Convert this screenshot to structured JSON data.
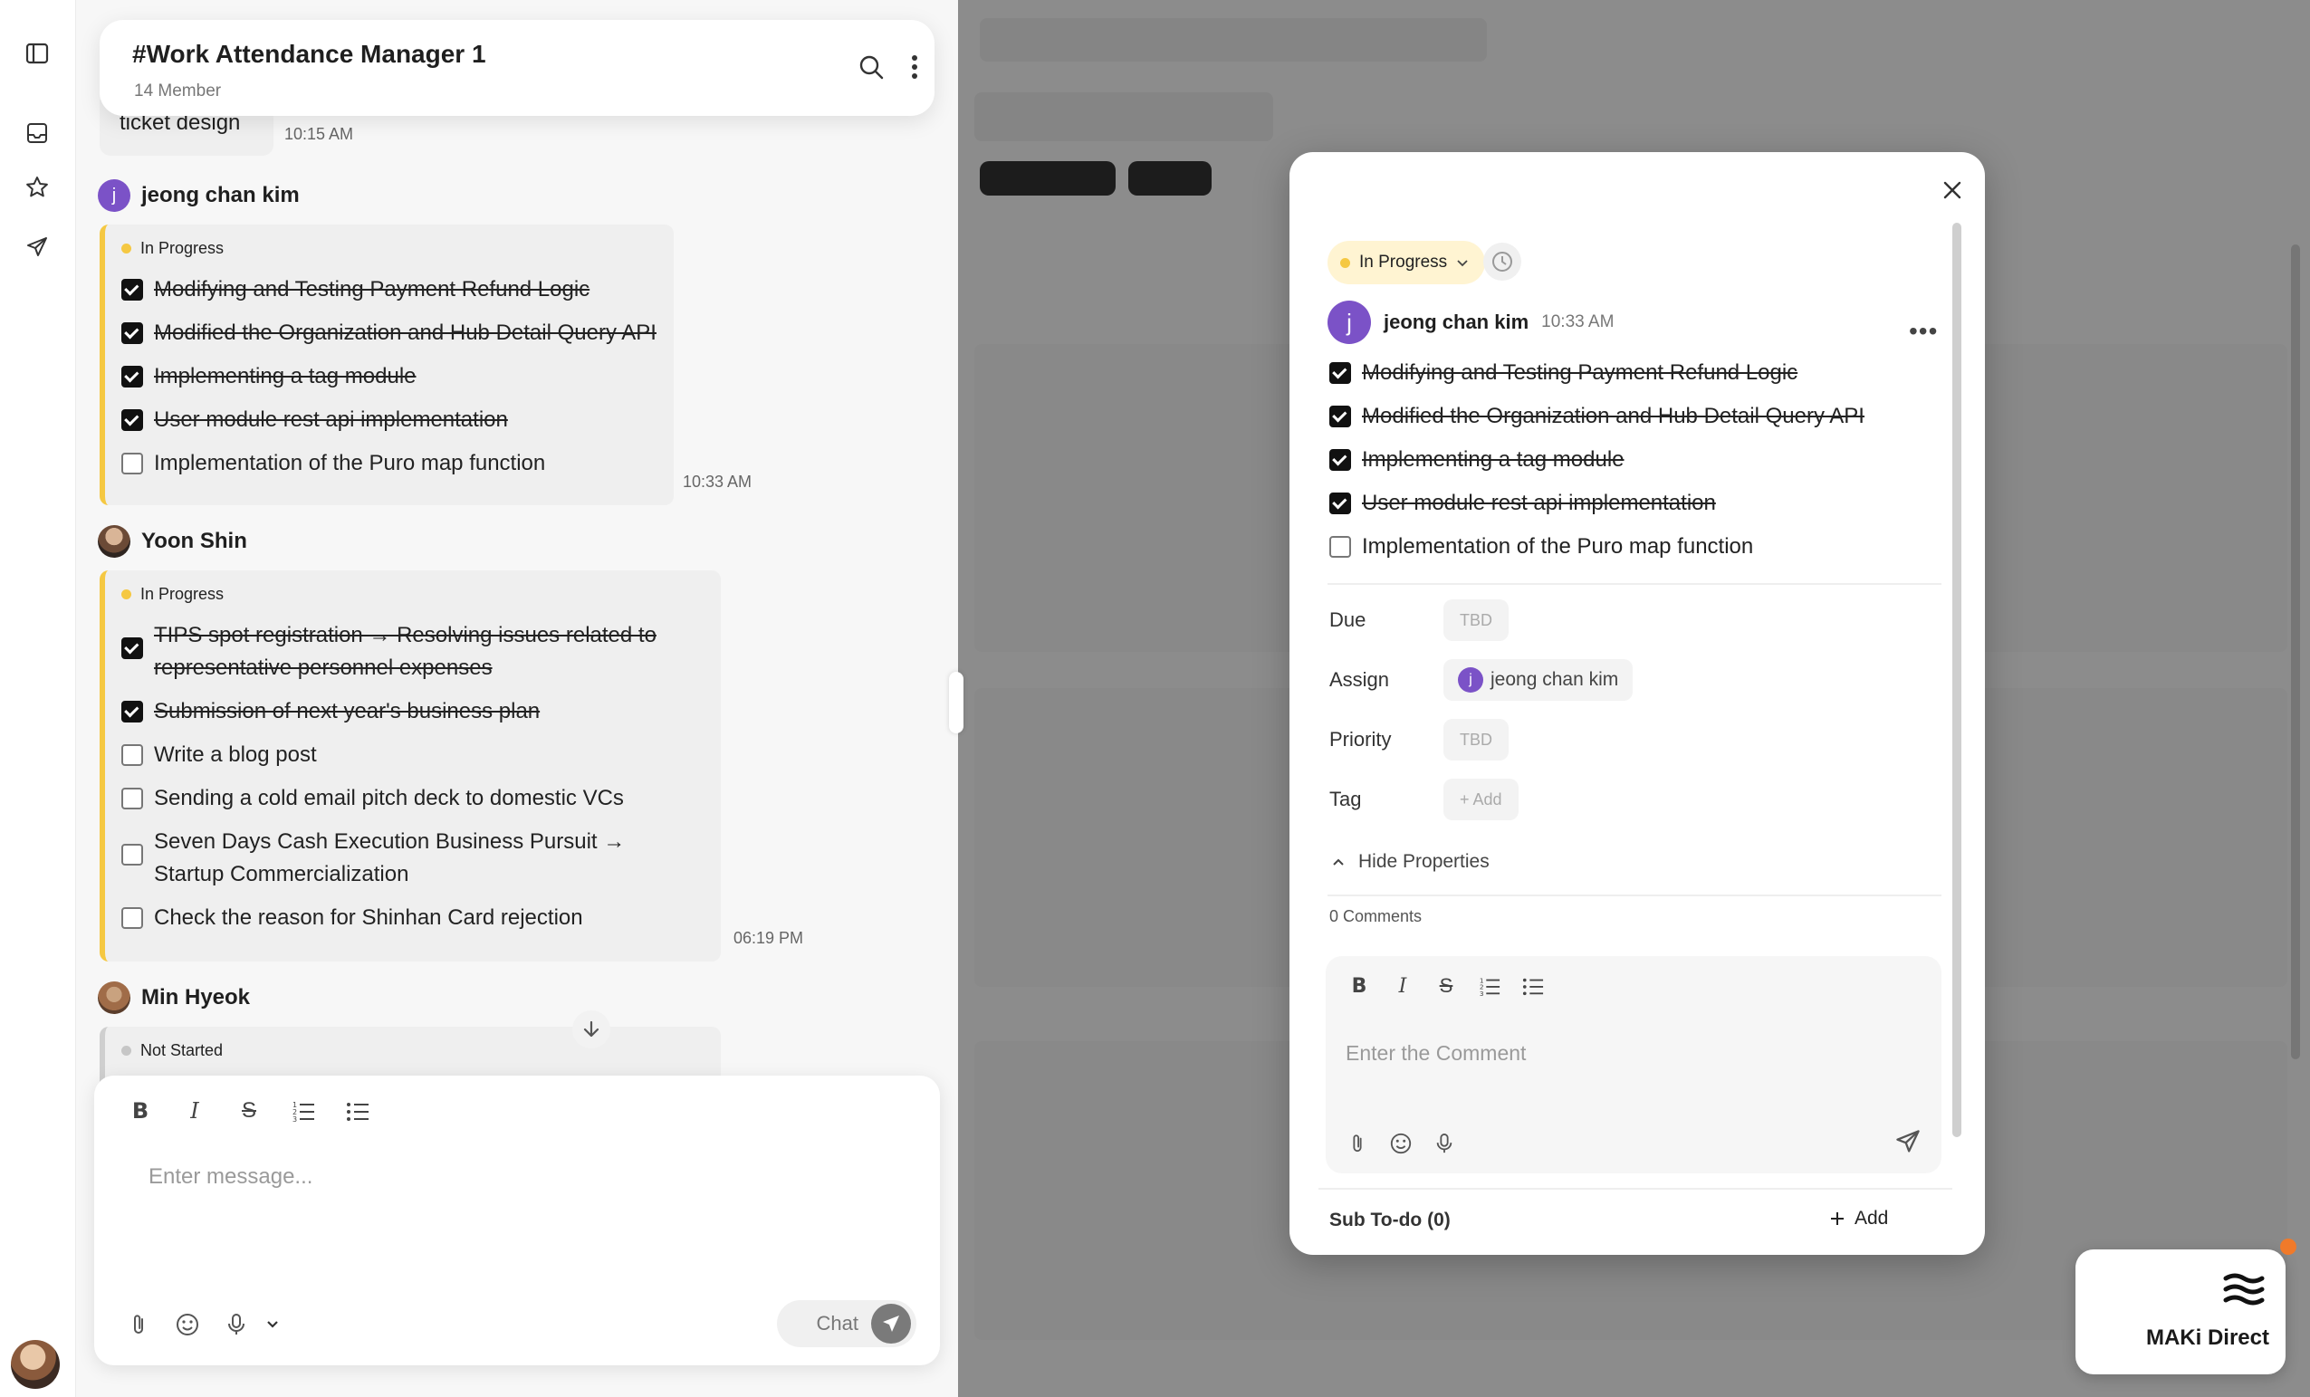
{
  "rail": {
    "icons": [
      "sidebar-toggle-icon",
      "inbox-icon",
      "star-icon",
      "send-icon"
    ]
  },
  "channel": {
    "title": "#Work Attendance Manager 1",
    "members": "14 Member"
  },
  "messages": [
    {
      "partial_text": "ticket design",
      "time": "10:15 AM"
    },
    {
      "author": "jeong chan kim",
      "avatar_letter": "j",
      "status": "In Progress",
      "time": "10:33 AM",
      "items": [
        {
          "text": "Modifying and Testing Payment Refund Logic",
          "done": true
        },
        {
          "text": "Modified the Organization and Hub Detail Query API",
          "done": true
        },
        {
          "text": "Implementing a tag module",
          "done": true
        },
        {
          "text": "User module rest api implementation",
          "done": true
        },
        {
          "text": "Implementation of the Puro map function",
          "done": false
        }
      ]
    },
    {
      "author": "Yoon Shin",
      "status": "In Progress",
      "time": "06:19 PM",
      "items": [
        {
          "text": "TIPS spot registration → Resolving issues related to representative personnel expenses",
          "done": true
        },
        {
          "text": "Submission of next year's business plan",
          "done": true
        },
        {
          "text": "Write a blog post",
          "done": false
        },
        {
          "text": "Sending a cold email pitch deck to domestic VCs",
          "done": false
        },
        {
          "text": "Seven Days Cash Execution Business Pursuit → Startup Commercialization",
          "done": false
        },
        {
          "text": "Check the reason for Shinhan Card rejection",
          "done": false
        }
      ]
    },
    {
      "author": "Min Hyeok",
      "status": "Not Started"
    }
  ],
  "composer": {
    "placeholder": "Enter message...",
    "chat_label": "Chat"
  },
  "modal": {
    "status": "In Progress",
    "author": "jeong chan kim",
    "avatar_letter": "j",
    "time": "10:33 AM",
    "items": [
      {
        "text": "Modifying and Testing Payment Refund Logic",
        "done": true
      },
      {
        "text": "Modified the Organization and Hub Detail Query API",
        "done": true
      },
      {
        "text": "Implementing a tag module",
        "done": true
      },
      {
        "text": "User module rest api implementation",
        "done": true
      },
      {
        "text": "Implementation of the Puro map function",
        "done": false
      }
    ],
    "props": {
      "due_label": "Due",
      "due_value": "TBD",
      "assign_label": "Assign",
      "assign_value": "jeong chan kim",
      "priority_label": "Priority",
      "priority_value": "TBD",
      "tag_label": "Tag",
      "tag_value": "+ Add"
    },
    "hide_label": "Hide Properties",
    "comments": "0 Comments",
    "comment_placeholder": "Enter the Comment",
    "subtodo": "Sub To-do (0)",
    "add_label": "Add"
  },
  "maki": {
    "label": "MAKi Direct",
    "accent": "#f07a2a"
  },
  "colors": {
    "in_progress": "#f5c842",
    "not_started": "#c6c6c6",
    "avatar": "#7b52c7"
  }
}
